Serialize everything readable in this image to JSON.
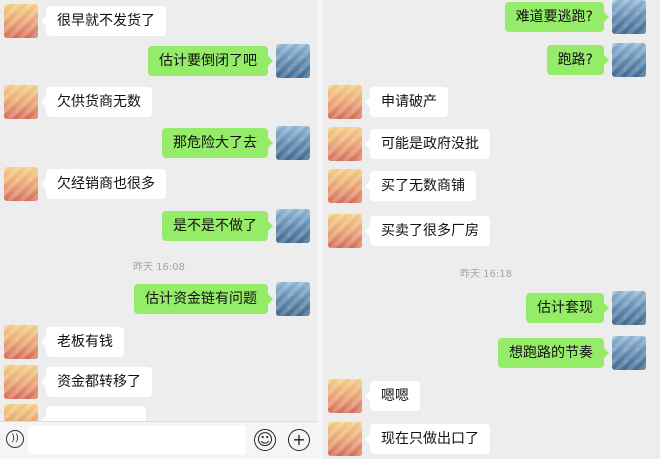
{
  "left_panel": {
    "messages": [
      {
        "side": "in",
        "text": "很早就不发货了"
      },
      {
        "side": "out",
        "text": "估计要倒闭了吧"
      },
      {
        "side": "in",
        "text": "欠供货商无数"
      },
      {
        "side": "out",
        "text": "那危险大了去"
      },
      {
        "side": "in",
        "text": "欠经销商也很多"
      },
      {
        "side": "out",
        "text": "是不是不做了"
      },
      {
        "side": "out",
        "text": "估计资金链有问题"
      },
      {
        "side": "in",
        "text": "老板有钱"
      },
      {
        "side": "in",
        "text": "资金都转移了"
      }
    ],
    "timestamp": "昨天 16:08",
    "input_bar": {
      "voice_icon": "voice-icon",
      "emoji_icon": "emoji-icon",
      "plus_icon": "plus-icon"
    }
  },
  "right_panel": {
    "messages": [
      {
        "side": "out",
        "text": "难道要逃跑?"
      },
      {
        "side": "out",
        "text": "跑路?"
      },
      {
        "side": "in",
        "text": "申请破产"
      },
      {
        "side": "in",
        "text": "可能是政府没批"
      },
      {
        "side": "in",
        "text": "买了无数商铺"
      },
      {
        "side": "in",
        "text": "买卖了很多厂房"
      },
      {
        "side": "out",
        "text": "估计套现"
      },
      {
        "side": "out",
        "text": "想跑路的节奏"
      },
      {
        "side": "in",
        "text": "嗯嗯"
      },
      {
        "side": "in",
        "text": "现在只做出口了"
      }
    ],
    "timestamp": "昨天 16:18"
  },
  "colors": {
    "background": "#ededed",
    "incoming_bubble": "#ffffff",
    "outgoing_bubble": "#95ec69",
    "timestamp_text": "#a3a3a3"
  }
}
